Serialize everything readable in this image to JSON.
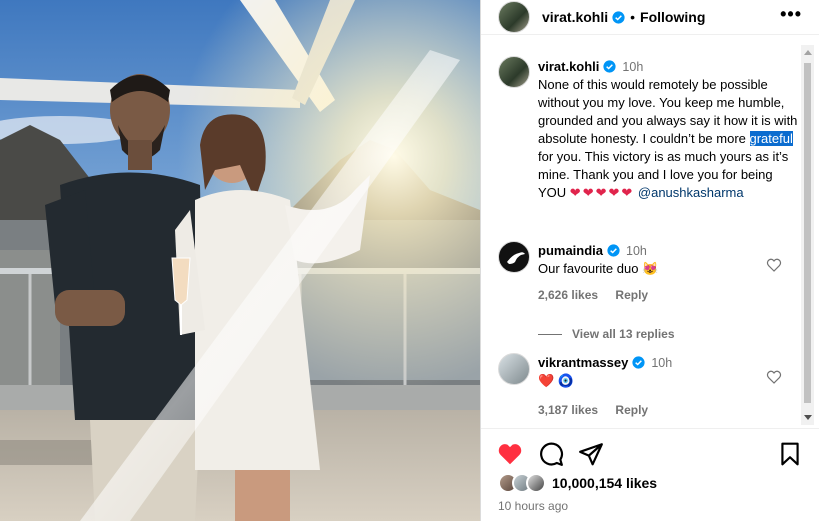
{
  "post": {
    "username": "virat.kohli",
    "follow_state": "Following",
    "more_glyph": "•••"
  },
  "caption": {
    "username": "virat.kohli",
    "time": "10h",
    "text_before": "None of this would remotely be possible without you my love. You keep me humble, grounded and you always say it how it is with absolute honesty. I couldn’t be more ",
    "highlighted": "grateful",
    "text_after": " for you. This victory is as much yours as it’s mine. Thank you and I love you for being YOU ",
    "hearts": "❤❤❤❤❤",
    "mention": "@anushkasharma"
  },
  "comments": [
    {
      "username": "pumaindia",
      "time": "10h",
      "text": "Our favourite duo 😻",
      "likes": "2,626 likes",
      "reply": "Reply"
    },
    {
      "username": "vikrantmassey",
      "time": "10h",
      "text": "❤️ 🧿",
      "likes": "3,187 likes",
      "reply": "Reply"
    }
  ],
  "view_replies": "View all 13 replies",
  "footer": {
    "likes": "10,000,154 likes",
    "ago": "10 hours ago"
  },
  "icons": {
    "verified": "verified-badge-icon",
    "heart_filled": "heart-filled-icon",
    "comment": "comment-icon",
    "share": "share-icon",
    "save": "bookmark-icon",
    "like_outline": "heart-outline-icon"
  },
  "colors": {
    "like_red": "#ff3040",
    "verified_blue": "#0095f6",
    "highlight": "#0b6ccf"
  }
}
